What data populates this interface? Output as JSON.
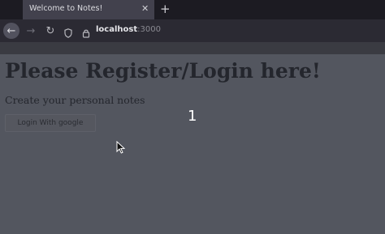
{
  "browser": {
    "tab": {
      "title": "Welcome to Notes!",
      "close_glyph": "✕"
    },
    "new_tab_glyph": "+",
    "nav": {
      "back_glyph": "←",
      "forward_glyph": "→",
      "reload_glyph": "↻"
    },
    "url": {
      "host": "localhost",
      "port": ":3000"
    }
  },
  "page": {
    "heading": "Please Register/Login here!",
    "subtitle": "Create your personal notes",
    "login_button": "Login With google"
  },
  "overlay": {
    "label": "1"
  },
  "icons": {
    "shield": "shield-icon",
    "lock": "lock-icon",
    "cursor": "mouse-pointer-icon"
  }
}
